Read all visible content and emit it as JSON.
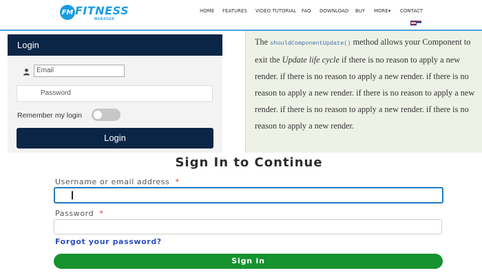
{
  "header": {
    "logo": {
      "badge": "FM",
      "word": "FITNESS",
      "sub": "MANAGER",
      "color": "#1a9be0"
    },
    "nav": [
      "HOME",
      "FEATURES",
      "VIDEO TUTORIAL",
      "FAQ",
      "DOWNLOAD",
      "BUY",
      "MORE▾",
      "CONTACT"
    ],
    "flags": [
      "english-flag-icon",
      "serbian-flag-icon"
    ]
  },
  "login_panel": {
    "title": "Login",
    "email_placeholder": "Email",
    "password_placeholder": "Password",
    "remember_label": "Remember my login",
    "remember_on": false,
    "button_label": "Login",
    "colors": {
      "header": "#0b2546",
      "button": "#0b2546"
    }
  },
  "doc": {
    "word_the": "The",
    "code": "shouldComponentUpdate()",
    "after_code": " method allows your Component to exit the ",
    "emph": "Update life cycle",
    "rest": " if there is no reason to apply a new render. if there is no reason to apply a new render. if there is no reason to apply a new render. if there is no reason to apply a new render. if there is no reason to apply a new render. if there is no reason to apply a new render."
  },
  "signin": {
    "title": "Sign In to Continue",
    "username_label": "Username or email address",
    "password_label": "Password",
    "required_mark": "*",
    "username_value": "",
    "password_value": "",
    "forgot_link": "Forgot your password?",
    "button_label": "Sign in",
    "colors": {
      "button": "#16922f",
      "link": "#2a4fbf",
      "focus": "#1f79c4"
    }
  }
}
